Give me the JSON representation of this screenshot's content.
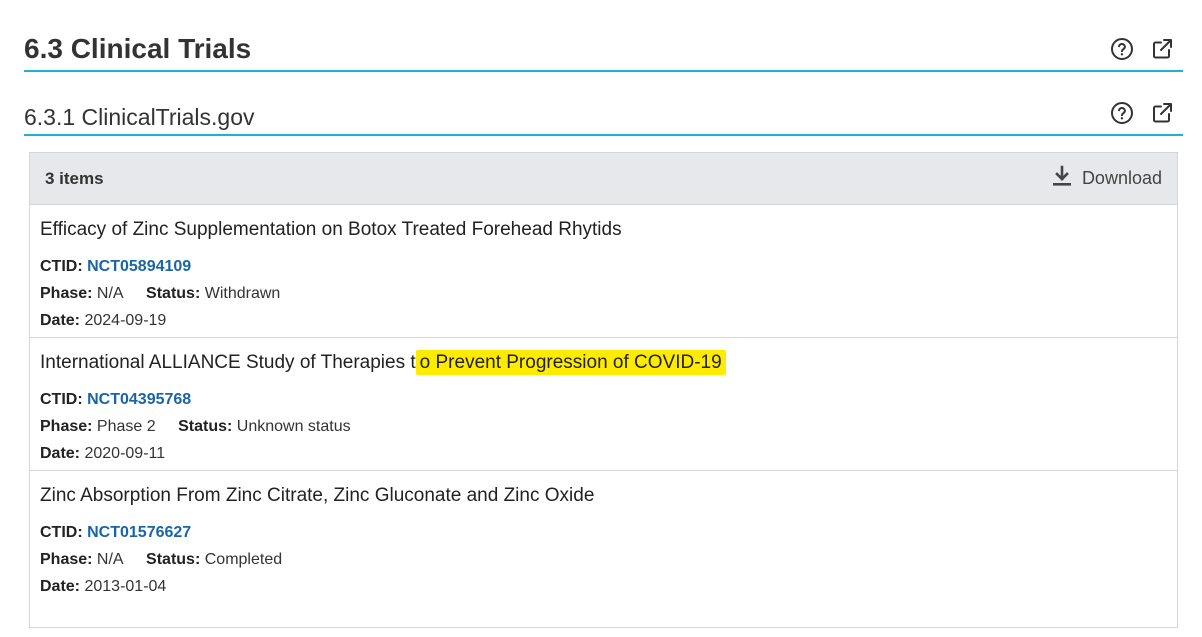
{
  "sections": {
    "main_title": "6.3 Clinical Trials",
    "sub_title": "6.3.1 ClinicalTrials.gov"
  },
  "icons": {
    "help": "help-circle-icon",
    "external": "external-link-icon",
    "download": "download-icon"
  },
  "panel": {
    "count_label": "3 items",
    "download_label": "Download"
  },
  "labels": {
    "ctid": "CTID:",
    "phase": "Phase:",
    "status": "Status:",
    "date": "Date:"
  },
  "trials": [
    {
      "title": "Efficacy of Zinc Supplementation on Botox Treated Forehead Rhytids",
      "ctid": "NCT05894109",
      "phase": "N/A",
      "status": "Withdrawn",
      "date": "2024-09-19"
    },
    {
      "title_prefix": "International ALLIANCE Study of Therapies t",
      "title_highlight": "o Prevent Progression of COVID-19",
      "ctid": "NCT04395768",
      "phase": "Phase 2",
      "status": "Unknown status",
      "date": "2020-09-11"
    },
    {
      "title": "Zinc Absorption From Zinc Citrate, Zinc Gluconate and Zinc Oxide",
      "ctid": "NCT01576627",
      "phase": "N/A",
      "status": "Completed",
      "date": "2013-01-04"
    }
  ],
  "colors": {
    "accent_line": "#20b3cf",
    "link": "#1a64a8",
    "highlight": "#ffeb00",
    "panel_bar": "#e6e8eb"
  }
}
